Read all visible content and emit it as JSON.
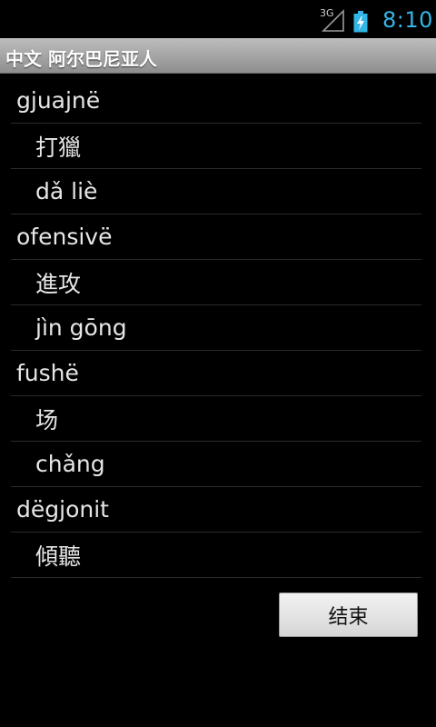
{
  "status_bar": {
    "network_type": "3G",
    "clock": "8:10",
    "accent_color": "#33b5e5"
  },
  "title_bar": {
    "title": "中文 阿尔巴尼亚人"
  },
  "entries": [
    {
      "word": "gjuajnë",
      "translation": "打獵",
      "pinyin": "dǎ liè"
    },
    {
      "word": "ofensivë",
      "translation": "進攻",
      "pinyin": "jìn gōng"
    },
    {
      "word": "fushë",
      "translation": "场",
      "pinyin": "chǎng"
    },
    {
      "word": "dëgjonit",
      "translation": "傾聽"
    }
  ],
  "end_button_label": "结束"
}
